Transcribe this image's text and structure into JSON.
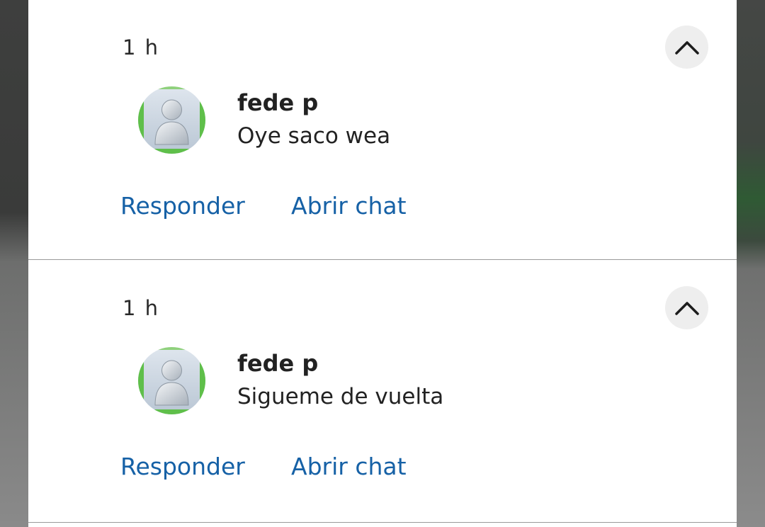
{
  "notifications": [
    {
      "time": "1 h",
      "sender": "fede p",
      "message": "Oye saco wea",
      "actions": {
        "reply": "Responder",
        "open_chat": "Abrir chat"
      }
    },
    {
      "time": "1 h",
      "sender": "fede p",
      "message": "Sigueme de vuelta",
      "actions": {
        "reply": "Responder",
        "open_chat": "Abrir chat"
      }
    }
  ],
  "icons": {
    "collapse": "chevron-up-icon",
    "avatar": "user-avatar-icon"
  },
  "colors": {
    "action_link": "#1661a6",
    "avatar_ring": "#5fbf4a",
    "card_background": "#ffffff"
  }
}
